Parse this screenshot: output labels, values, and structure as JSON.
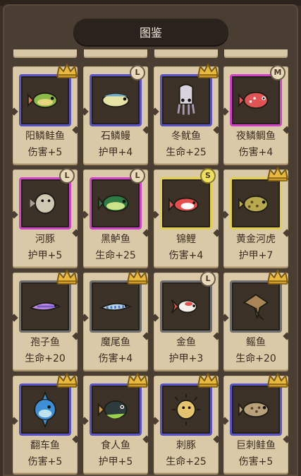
{
  "header": {
    "title": "图鉴"
  },
  "colors": {
    "blue_frame": "#5a52c8",
    "pink_frame": "#d043c8",
    "gold_frame": "#e3d04a",
    "gray_frame": "#6f6f6f",
    "card": "#d9c9a6",
    "panel": "#4a3d31"
  },
  "cards": [
    {
      "name": "阳鳞鲑鱼",
      "stat": "伤害+5",
      "frame": "blue",
      "badge": "crown",
      "rank": "",
      "fish": "green-trout"
    },
    {
      "name": "石鳞鳗",
      "stat": "护甲+4",
      "frame": "blue",
      "badge": "rank",
      "rank": "L",
      "fish": "stone-eel"
    },
    {
      "name": "冬鱿鱼",
      "stat": "生命+25",
      "frame": "blue",
      "badge": "crown",
      "rank": "",
      "fish": "squid"
    },
    {
      "name": "夜鳞鲷鱼",
      "stat": "伤害+4",
      "frame": "pink",
      "badge": "rank",
      "rank": "M",
      "fish": "red-bream"
    },
    {
      "name": "河豚",
      "stat": "护甲+5",
      "frame": "pink",
      "badge": "rank",
      "rank": "L",
      "fish": "puffer"
    },
    {
      "name": "黑鲈鱼",
      "stat": "生命+25",
      "frame": "pink",
      "badge": "rank",
      "rank": "L",
      "fish": "bass"
    },
    {
      "name": "锦鲤",
      "stat": "伤害+4",
      "frame": "gold",
      "badge": "rank",
      "rank": "S",
      "fish": "koi"
    },
    {
      "name": "黄金河虎",
      "stat": "护甲+7",
      "frame": "gold",
      "badge": "crown",
      "rank": "",
      "fish": "golden-puffer"
    },
    {
      "name": "孢子鱼",
      "stat": "生命+20",
      "frame": "gray",
      "badge": "crown",
      "rank": "",
      "fish": "spore-fish"
    },
    {
      "name": "魔尾鱼",
      "stat": "伤害+4",
      "frame": "gray",
      "badge": "crown",
      "rank": "",
      "fish": "tail-fish"
    },
    {
      "name": "金鱼",
      "stat": "护甲+3",
      "frame": "gray",
      "badge": "rank",
      "rank": "L",
      "fish": "goldfish"
    },
    {
      "name": "鳐鱼",
      "stat": "生命+20",
      "frame": "gray",
      "badge": "crown",
      "rank": "",
      "fish": "ray"
    },
    {
      "name": "翻车鱼",
      "stat": "伤害+5",
      "frame": "blue",
      "badge": "crown",
      "rank": "",
      "fish": "sunfish"
    },
    {
      "name": "食人鱼",
      "stat": "护甲+5",
      "frame": "blue",
      "badge": "crown",
      "rank": "",
      "fish": "piranha"
    },
    {
      "name": "刺豚",
      "stat": "生命+25",
      "frame": "blue",
      "badge": "crown",
      "rank": "",
      "fish": "porcupine"
    },
    {
      "name": "巨刺鲑鱼",
      "stat": "伤害+5",
      "frame": "blue",
      "badge": "crown",
      "rank": "",
      "fish": "big-trout"
    }
  ]
}
